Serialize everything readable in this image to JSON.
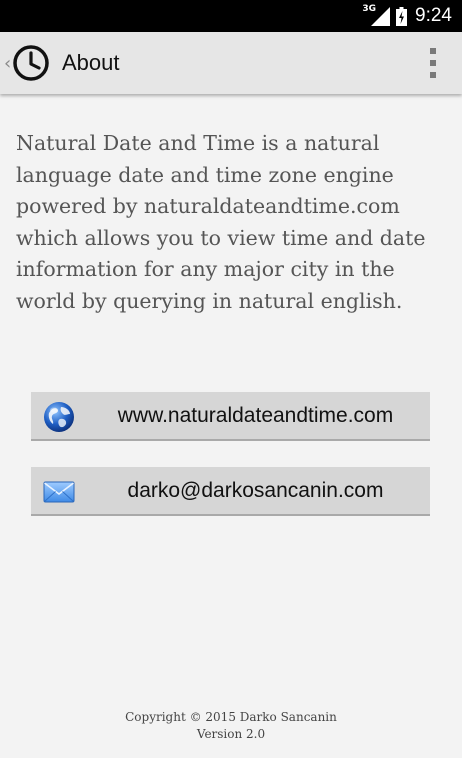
{
  "status_bar": {
    "network": "3G",
    "time": "9:24"
  },
  "action_bar": {
    "title": "About",
    "icons": {
      "back": "chevron-left-icon",
      "app": "clock-icon",
      "overflow": "overflow-menu-icon"
    }
  },
  "description": "Natural Date and Time is a natural language date and time zone engine powered by naturaldateandtime.com which allows you to view time and date information for any major city in the world by querying in natural english.",
  "buttons": {
    "website": {
      "label": "www.naturaldateandtime.com",
      "icon": "globe-icon"
    },
    "email": {
      "label": "darko@darkosancanin.com",
      "icon": "envelope-icon"
    }
  },
  "footer": {
    "copyright": "Copyright © 2015 Darko Sancanin",
    "version": "Version 2.0"
  },
  "colors": {
    "status_bar_bg": "#000000",
    "action_bar_bg": "#e6e6e6",
    "page_bg": "#f3f3f3",
    "button_bg": "#d6d6d6",
    "text_muted": "#555555"
  }
}
